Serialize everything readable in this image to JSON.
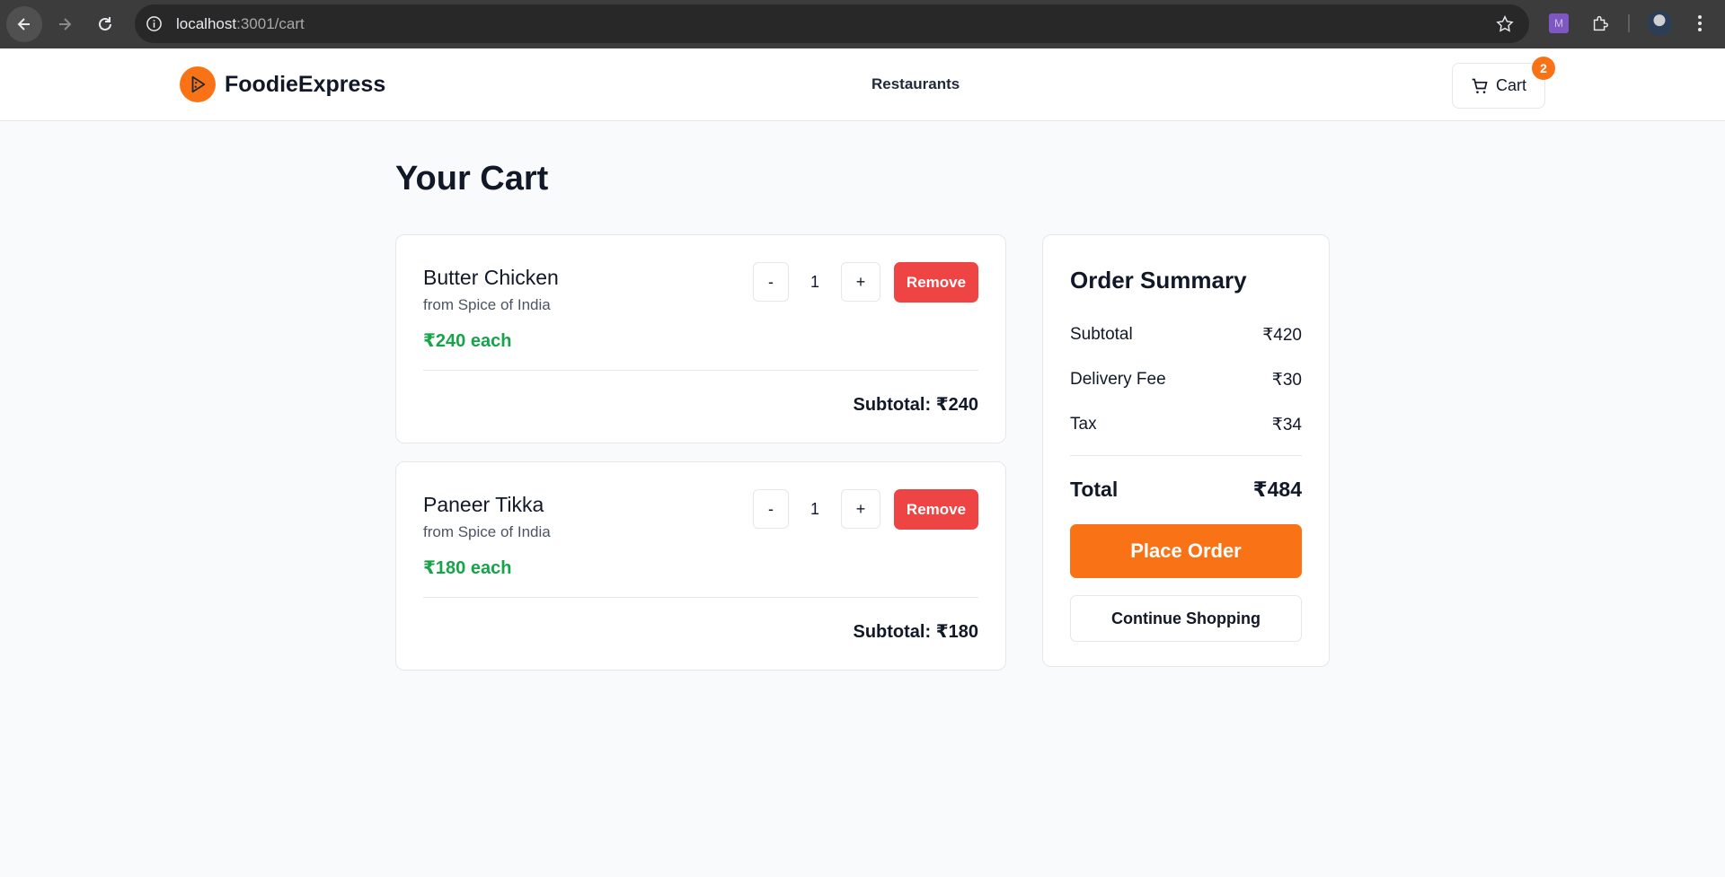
{
  "browser": {
    "url_host": "localhost",
    "url_path": ":3001/cart",
    "ext_label": "M"
  },
  "header": {
    "brand": "FoodieExpress",
    "nav_restaurants": "Restaurants",
    "cart_label": "Cart",
    "cart_count": "2",
    "accent": "#f97316"
  },
  "page": {
    "title": "Your Cart"
  },
  "items": [
    {
      "name": "Butter Chicken",
      "restaurant": "from Spice of India",
      "price": "₹240 each",
      "minus": "-",
      "qty": "1",
      "plus": "+",
      "remove": "Remove",
      "subtotal": "Subtotal: ₹240"
    },
    {
      "name": "Paneer Tikka",
      "restaurant": "from Spice of India",
      "price": "₹180 each",
      "minus": "-",
      "qty": "1",
      "plus": "+",
      "remove": "Remove",
      "subtotal": "Subtotal: ₹180"
    }
  ],
  "summary": {
    "title": "Order Summary",
    "subtotal_label": "Subtotal",
    "subtotal_value": "₹420",
    "delivery_label": "Delivery Fee",
    "delivery_value": "₹30",
    "tax_label": "Tax",
    "tax_value": "₹34",
    "total_label": "Total",
    "total_value": "₹484",
    "place_order": "Place Order",
    "continue": "Continue Shopping"
  },
  "colors": {
    "remove": "#ef4444",
    "price": "#16a34a"
  }
}
